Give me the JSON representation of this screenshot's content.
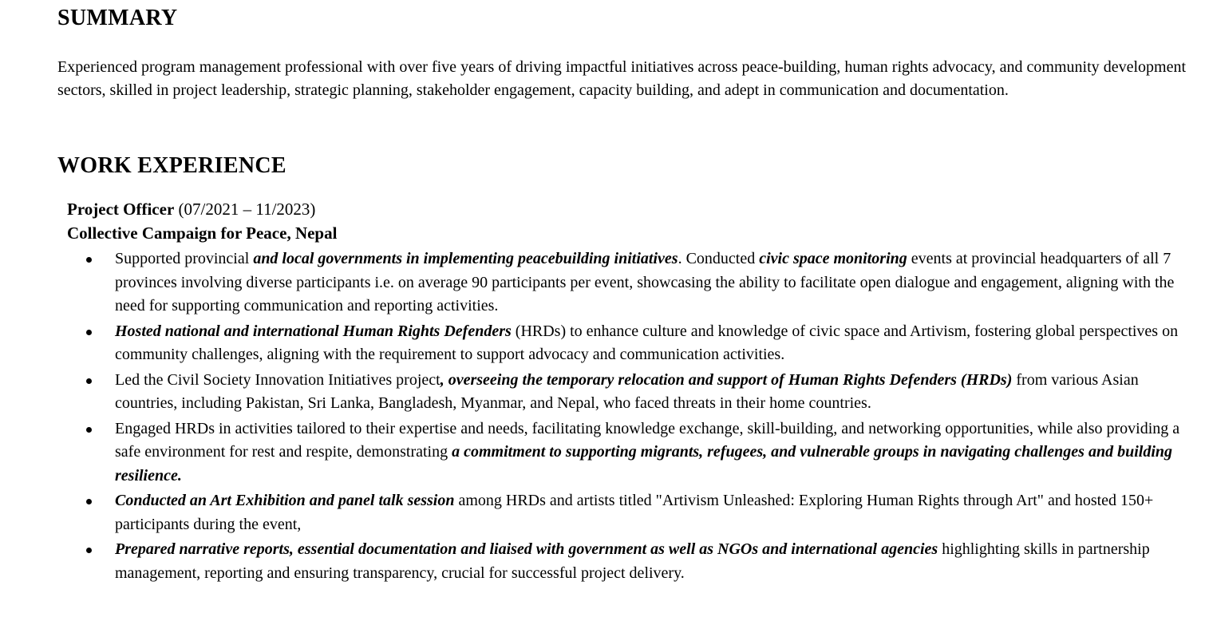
{
  "summary": {
    "heading": "SUMMARY",
    "text": "Experienced program management professional with over five years of driving impactful initiatives across peace-building, human rights advocacy, and community development sectors, skilled in project leadership, strategic planning, stakeholder engagement, capacity building, and adept in communication and documentation."
  },
  "work": {
    "heading": "WORK EXPERIENCE",
    "job": {
      "title": "Project Officer",
      "dates": " (07/2021 – 11/2023)",
      "organization": "Collective Campaign for Peace, Nepal",
      "bullets": [
        {
          "segments": [
            {
              "text": "Supported provincial ",
              "emphasis": false
            },
            {
              "text": "and local governments in implementing peacebuilding initiatives",
              "emphasis": true
            },
            {
              "text": ". Conducted ",
              "emphasis": false
            },
            {
              "text": "civic space monitoring",
              "emphasis": true
            },
            {
              "text": " events at provincial headquarters of all 7 provinces involving diverse participants i.e. on average 90 participants per event, showcasing the ability to facilitate open dialogue and engagement, aligning with the need for supporting communication and reporting activities.",
              "emphasis": false
            }
          ]
        },
        {
          "segments": [
            {
              "text": "Hosted national and international Human Rights Defenders",
              "emphasis": true
            },
            {
              "text": " (HRDs) to enhance culture and knowledge of civic space and Artivism, fostering global perspectives on community challenges, aligning with the requirement to support advocacy and communication activities.",
              "emphasis": false
            }
          ]
        },
        {
          "segments": [
            {
              "text": "Led the Civil Society Innovation Initiatives project",
              "emphasis": false
            },
            {
              "text": ", overseeing the temporary relocation and support of Human Rights Defenders (HRDs)",
              "emphasis": true
            },
            {
              "text": " from various Asian countries, including Pakistan, Sri Lanka, Bangladesh, Myanmar, and Nepal, who faced threats in their home countries.",
              "emphasis": false
            }
          ]
        },
        {
          "segments": [
            {
              "text": "Engaged HRDs in activities tailored to their expertise and needs, facilitating knowledge exchange, skill-building, and networking opportunities, while also providing a safe environment for rest and respite, demonstrating ",
              "emphasis": false
            },
            {
              "text": "a commitment to supporting migrants, refugees, and vulnerable groups in navigating challenges and building resilience.",
              "emphasis": true
            }
          ]
        },
        {
          "segments": [
            {
              "text": "Conducted an Art Exhibition and panel talk session",
              "emphasis": true
            },
            {
              "text": " among HRDs and artists titled \"Artivism Unleashed: Exploring Human Rights through Art\" and hosted 150+ participants during the event,",
              "emphasis": false
            }
          ]
        },
        {
          "segments": [
            {
              "text": "Prepared narrative reports, essential documentation and liaised with government as well as NGOs and international agencies",
              "emphasis": true
            },
            {
              "text": " highlighting skills in partnership management, reporting and ensuring transparency, crucial for successful project delivery.",
              "emphasis": false
            }
          ]
        }
      ]
    }
  }
}
